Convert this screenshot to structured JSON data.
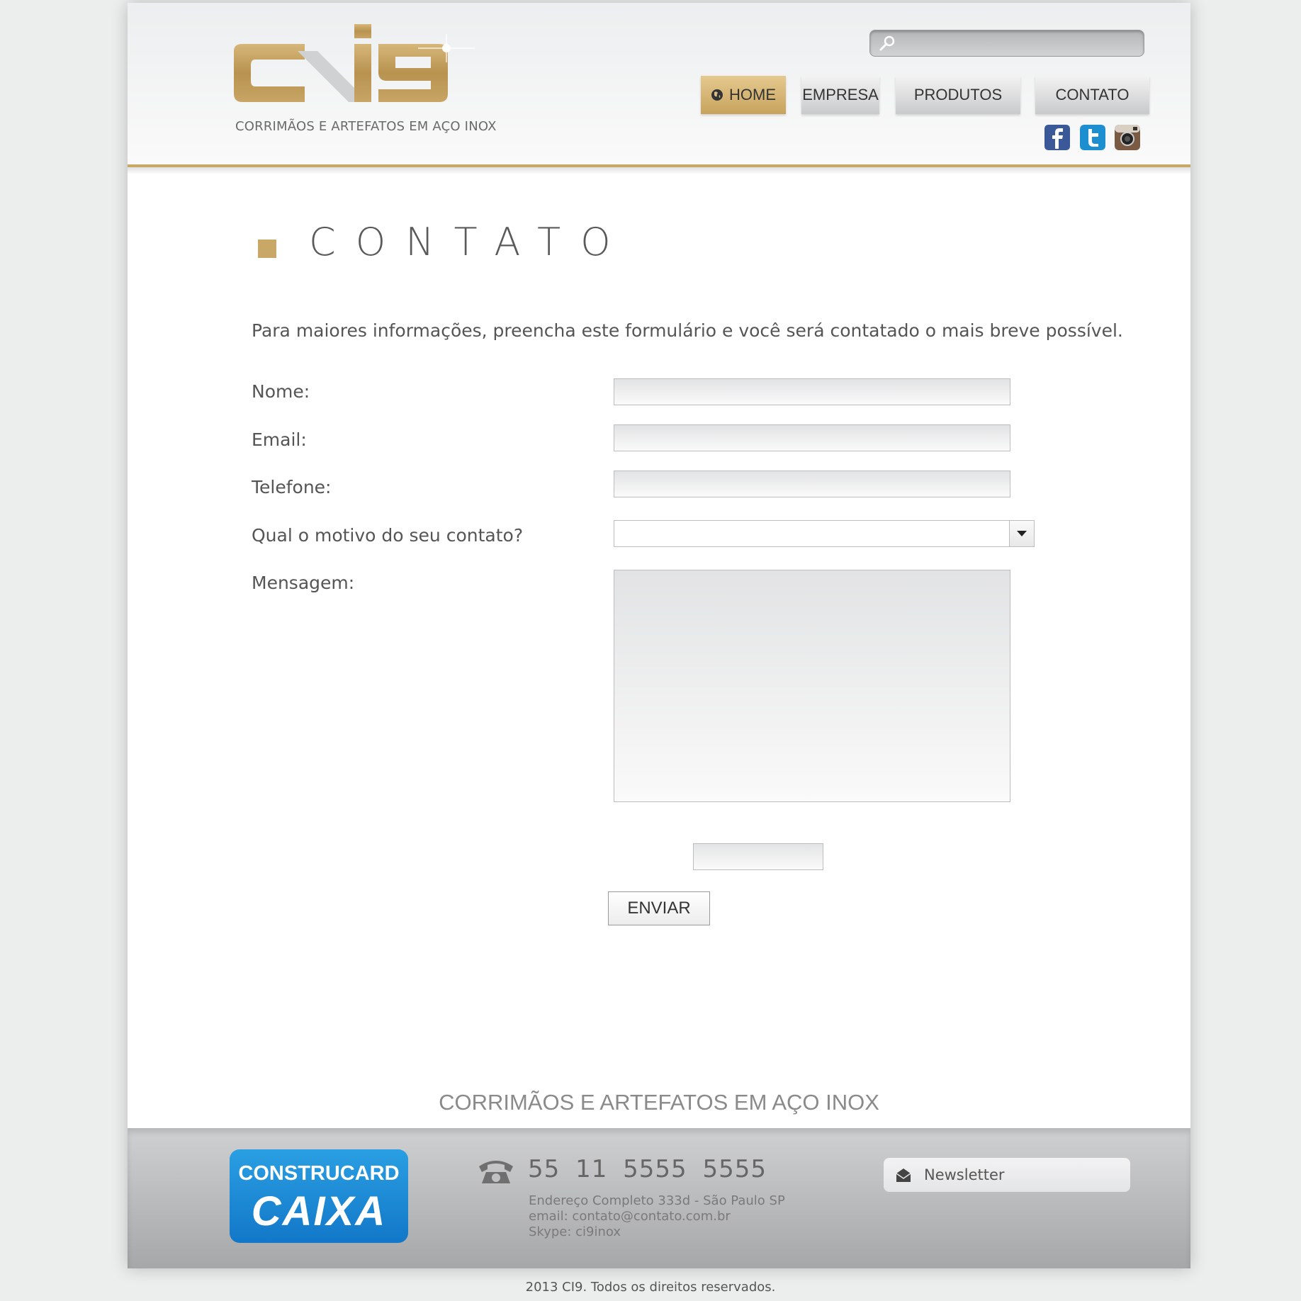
{
  "brand": {
    "logo_text": "ci9",
    "tagline": "CORRIMÃOS E ARTEFATOS EM AÇO INOX",
    "gold": "#c9a867"
  },
  "search": {
    "placeholder": "",
    "icon": "search-icon"
  },
  "nav": {
    "items": [
      {
        "label": "HOME",
        "active": true,
        "icon": "globe-icon"
      },
      {
        "label": "EMPRESA",
        "active": false
      },
      {
        "label": "PRODUTOS",
        "active": false
      },
      {
        "label": "CONTATO",
        "active": false
      }
    ]
  },
  "social": [
    "facebook-icon",
    "twitter-icon",
    "instagram-icon"
  ],
  "main": {
    "title": "CONTATO",
    "intro": "Para maiores informações, preencha este formulário e você será contatado o mais breve possível.",
    "form": {
      "name_label": "Nome:",
      "email_label": "Email:",
      "phone_label": "Telefone:",
      "reason_label": "Qual o motivo do seu contato?",
      "reason_value": "",
      "message_label": "Mensagem:",
      "send_label": "ENVIAR"
    }
  },
  "footer": {
    "tagline": "CORRIMÃOS E ARTEFATOS EM AÇO INOX",
    "badge_top": "CONSTRUCARD",
    "badge_bottom": "CAIXA",
    "phone": "55  11  5555 5555",
    "address": "Endereço Completo 333d - São Paulo SP",
    "email": "email: contato@contato.com.br",
    "skype": "Skype: ci9inox",
    "newsletter_label": "Newsletter",
    "copyright": "2013 CI9. Todos os direitos reservados."
  }
}
